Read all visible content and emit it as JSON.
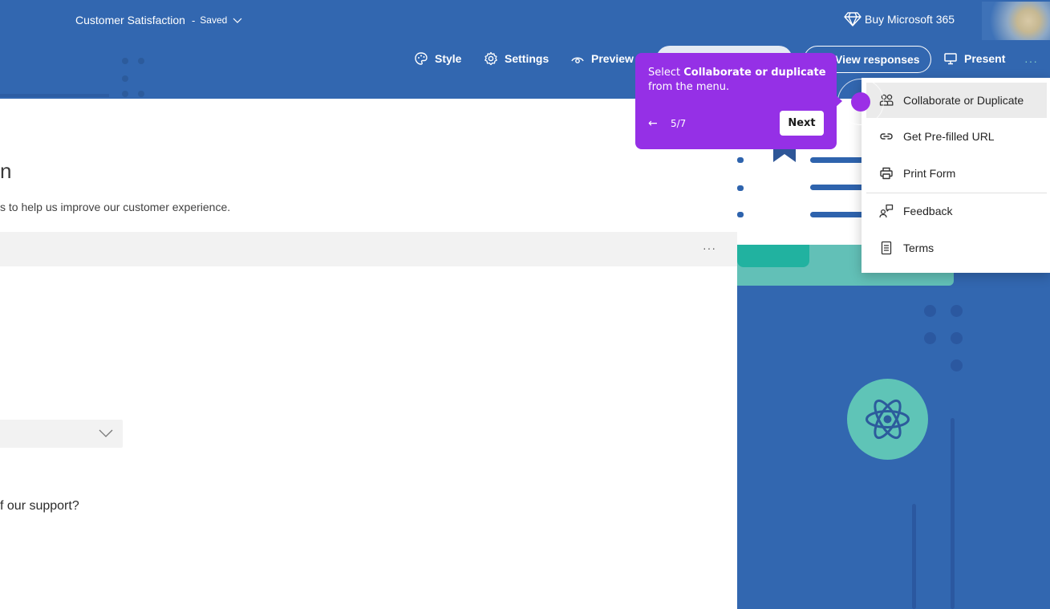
{
  "header": {
    "doc_title": "Customer Satisfaction",
    "separator": "-",
    "saved_status": "Saved",
    "buy_label": "Buy Microsoft 365",
    "buy_icon": "diamond-icon",
    "avatar_icon": "user-avatar",
    "commands": [
      {
        "label": "Style",
        "icon": "palette-icon"
      },
      {
        "label": "Settings",
        "icon": "gear-icon"
      },
      {
        "label": "Preview",
        "icon": "eye-icon"
      }
    ],
    "view_responses_label": "View responses",
    "present_label": "Present",
    "present_icon": "monitor-icon",
    "more_label": "···",
    "colors": {
      "header_bg": "#3267b0",
      "accent_teal": "#62c0b7"
    }
  },
  "form": {
    "title_fragment": "n",
    "description_fragment": "s to help us improve our customer experience.",
    "question_more": "···",
    "question_fragment": "f our support?"
  },
  "menu": {
    "items": [
      {
        "label": "Collaborate or Duplicate",
        "icon": "people-icon",
        "highlighted": true
      },
      {
        "label": "Get Pre-filled URL",
        "icon": "link-icon"
      },
      {
        "label": "Print Form",
        "icon": "printer-icon"
      },
      {
        "label": "Feedback",
        "icon": "feedback-icon"
      },
      {
        "label": "Terms",
        "icon": "document-icon"
      }
    ]
  },
  "guide": {
    "text_prefix": "Select ",
    "text_bold": "Collaborate or duplicate",
    "text_suffix": " from the menu.",
    "back_label": "←",
    "step": "5/7",
    "next_label": "Next",
    "color": "#9530e6"
  }
}
